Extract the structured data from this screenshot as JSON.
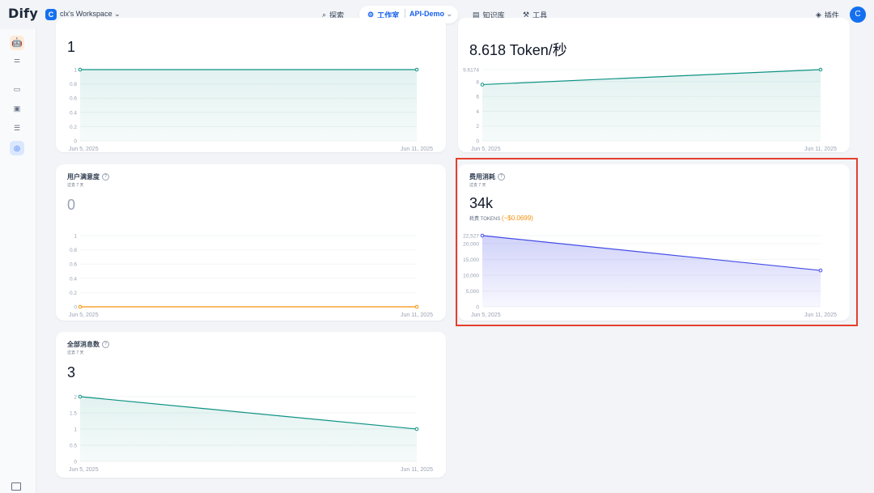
{
  "header": {
    "logo": "Dify",
    "workspace_badge": "C",
    "workspace_name": "clx's Workspace",
    "nav": {
      "explore": "探索",
      "studio": "工作室",
      "app_name": "API-Demo",
      "knowledge": "知识库",
      "tools": "工具",
      "plugins": "插件"
    },
    "avatar": "C"
  },
  "sidebar": {
    "icons": [
      "app-icon",
      "settings-icon",
      "overview-icon",
      "terminal-icon",
      "logs-icon",
      "monitoring-icon"
    ]
  },
  "cards": {
    "top_left": {
      "value": "1",
      "chart_data": {
        "type": "area",
        "x": [
          "Jun 5, 2025",
          "Jun 11, 2025"
        ],
        "values": [
          1,
          1
        ],
        "ylim": [
          0,
          1
        ],
        "yticks": [
          "1",
          "0.8",
          "0.6",
          "0.4",
          "0.2",
          "0"
        ],
        "xlabels": [
          "Jun 5, 2025",
          "Jun 11, 2025"
        ],
        "color": "#0e9384"
      }
    },
    "top_right": {
      "value": "8.618 Token/秒",
      "chart_data": {
        "type": "area",
        "x": [
          "Jun 5, 2025",
          "Jun 11, 2025"
        ],
        "values": [
          7.6,
          9.6174
        ],
        "ylim": [
          0,
          9.6174
        ],
        "yticks": [
          "9.6174",
          "8",
          "6",
          "4",
          "2",
          "0"
        ],
        "xlabels": [
          "Jun 5, 2025",
          "Jun 11, 2025"
        ],
        "color": "#0e9384"
      }
    },
    "satisfaction": {
      "title": "用户满意度",
      "subtitle": "过去 7 天",
      "value": "0",
      "chart_data": {
        "type": "area",
        "x": [
          "Jun 5, 2025",
          "Jun 11, 2025"
        ],
        "values": [
          0,
          0
        ],
        "ylim": [
          0,
          1
        ],
        "yticks": [
          "1",
          "0.8",
          "0.6",
          "0.4",
          "0.2",
          "0"
        ],
        "xlabels": [
          "Jun 5, 2025",
          "Jun 11, 2025"
        ],
        "color": "#f79009"
      }
    },
    "cost": {
      "title": "费用消耗",
      "subtitle": "过去 7 天",
      "value": "34k",
      "tokens_label": "耗费 TOKENS",
      "usd": "(~$0.0699)",
      "chart_data": {
        "type": "area",
        "x": [
          "Jun 5, 2025",
          "Jun 11, 2025"
        ],
        "values": [
          22527,
          11500
        ],
        "ylim": [
          0,
          22527
        ],
        "yticks": [
          "22,527",
          "20,000",
          "15,000",
          "10,000",
          "5,000",
          "0"
        ],
        "xlabels": [
          "Jun 5, 2025",
          "Jun 11, 2025"
        ],
        "color": "#444ce7"
      }
    },
    "messages": {
      "title": "全部消息数",
      "subtitle": "过去 7 天",
      "value": "3",
      "chart_data": {
        "type": "area",
        "x": [
          "Jun 5, 2025",
          "Jun 11, 2025"
        ],
        "values": [
          2,
          1
        ],
        "ylim": [
          0,
          2
        ],
        "yticks": [
          "2",
          "1.5",
          "1",
          "0.5",
          "0"
        ],
        "xlabels": [
          "Jun 5, 2025",
          "Jun 11, 2025"
        ],
        "color": "#0e9384"
      }
    }
  }
}
